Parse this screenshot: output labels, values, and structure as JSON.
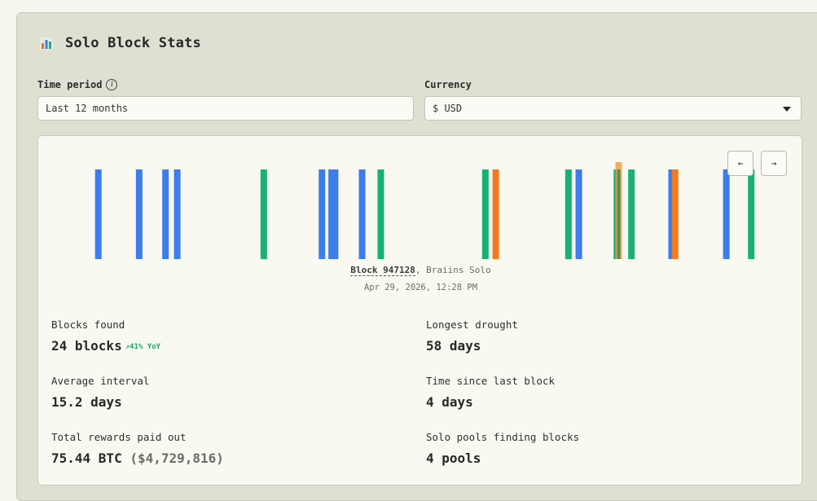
{
  "header": {
    "title": "Solo Block Stats"
  },
  "filters": {
    "time_period_label": "Time period",
    "time_period_value": "Last 12 months",
    "currency_label": "Currency",
    "currency_value": "$ USD"
  },
  "nav": {
    "prev": "←",
    "next": "→"
  },
  "colors": {
    "blue": "#3b7ded",
    "green": "#18b173",
    "orange": "#f47a1f",
    "highlight": "#f0a14a"
  },
  "selected_block": {
    "block_label": "Block 947128",
    "pool": ", Braiins Solo",
    "datetime": "Apr 29, 2026, 12:28 PM"
  },
  "stats": {
    "blocks_found_label": "Blocks found",
    "blocks_found_value": "24 blocks",
    "blocks_found_yoy": "↗41% YoY",
    "longest_drought_label": "Longest drought",
    "longest_drought_value": "58 days",
    "average_interval_label": "Average interval",
    "average_interval_value": "15.2 days",
    "time_since_label": "Time since last block",
    "time_since_value": "4 days",
    "rewards_label": "Total rewards paid out",
    "rewards_btc": "75.44 BTC",
    "rewards_usd": "($4,729,816)",
    "pools_label": "Solo pools finding blocks",
    "pools_value": "4 pools"
  },
  "chart_data": {
    "type": "timeline",
    "x_unit": "fraction of the 12-month window",
    "blocks": [
      {
        "x": 0.082,
        "pool": "blue"
      },
      {
        "x": 0.141,
        "pool": "blue"
      },
      {
        "x": 0.179,
        "pool": "blue"
      },
      {
        "x": 0.196,
        "pool": "blue"
      },
      {
        "x": 0.321,
        "pool": "green"
      },
      {
        "x": 0.405,
        "pool": "blue"
      },
      {
        "x": 0.419,
        "pool": "blue"
      },
      {
        "x": 0.424,
        "pool": "blue"
      },
      {
        "x": 0.463,
        "pool": "blue"
      },
      {
        "x": 0.49,
        "pool": "green"
      },
      {
        "x": 0.641,
        "pool": "green"
      },
      {
        "x": 0.656,
        "pool": "orange"
      },
      {
        "x": 0.761,
        "pool": "green"
      },
      {
        "x": 0.776,
        "pool": "blue"
      },
      {
        "x": 0.831,
        "pool": "green"
      },
      {
        "x": 0.836,
        "pool": "orange",
        "selected": true
      },
      {
        "x": 0.852,
        "pool": "green"
      },
      {
        "x": 0.91,
        "pool": "blue"
      },
      {
        "x": 0.915,
        "pool": "orange"
      },
      {
        "x": 0.989,
        "pool": "blue"
      },
      {
        "x": 1.025,
        "pool": "green"
      }
    ]
  }
}
